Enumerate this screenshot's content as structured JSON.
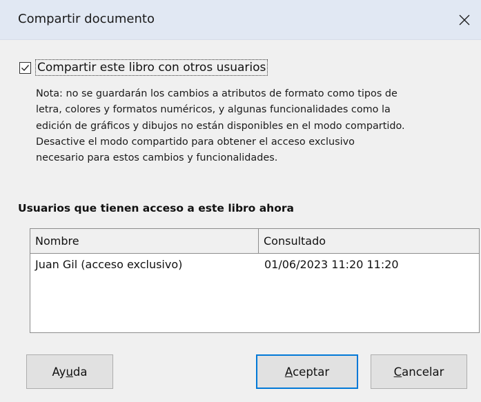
{
  "window": {
    "title": "Compartir documento"
  },
  "share": {
    "checked": true,
    "label": "Compartir este libro con otros usuarios"
  },
  "note": {
    "lines": [
      "Nota: no se guardarán los cambios a atributos de formato como tipos de",
      "letra, colores y formatos numéricos, y algunas funcionalidades como la",
      "edición de gráficos y dibujos no están disponibles en el modo compartido.",
      "Desactive el modo compartido para obtener el acceso exclusivo",
      "necesario para estos cambios y funcionalidades."
    ]
  },
  "users": {
    "heading": "Usuarios que tienen acceso a este libro ahora",
    "columns": [
      "Nombre",
      "Consultado"
    ],
    "rows": [
      [
        "Juan Gil (acceso exclusivo)",
        "01/06/2023 11:20 11:20"
      ]
    ]
  },
  "buttons": {
    "help": {
      "pre": "Ay",
      "mnemonic": "u",
      "post": "da"
    },
    "ok": {
      "pre": "",
      "mnemonic": "A",
      "post": "ceptar"
    },
    "cancel": {
      "pre": "",
      "mnemonic": "C",
      "post": "ancelar"
    }
  },
  "colors": {
    "titlebar": "#e1e8f3",
    "default_button_border": "#0078d7"
  },
  "icons": {
    "close": "close-icon",
    "check": "checkmark-icon"
  }
}
